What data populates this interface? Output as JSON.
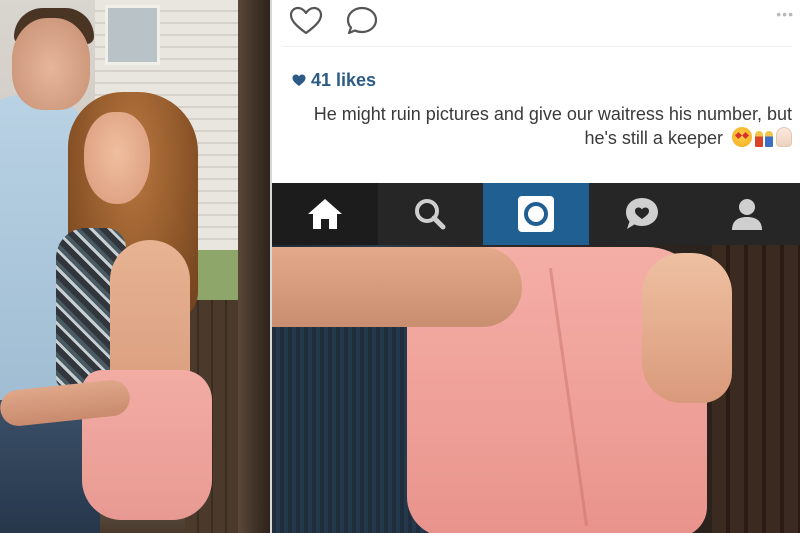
{
  "post": {
    "likes": "41 likes",
    "caption": "He might ruin pictures and give our waitress his number, but he's still a keeper",
    "caption_emojis": [
      "heart-eyes-emoji",
      "couple-emoji",
      "ok-hand-emoji"
    ],
    "more_menu_text": "•••"
  },
  "actions": [
    {
      "name": "like-button",
      "icon": "heart-outline-icon"
    },
    {
      "name": "comment-button",
      "icon": "comment-bubble-icon"
    }
  ],
  "nav": {
    "items": [
      {
        "name": "nav-home",
        "icon": "home-icon"
      },
      {
        "name": "nav-explore",
        "icon": "search-icon"
      },
      {
        "name": "nav-camera",
        "icon": "camera-icon",
        "active": true
      },
      {
        "name": "nav-activity",
        "icon": "heart-bubble-icon"
      },
      {
        "name": "nav-profile",
        "icon": "profile-icon"
      }
    ]
  },
  "colors": {
    "likes_text": "#2b5b86",
    "nav_background": "#262626",
    "nav_active": "#1f5f92"
  }
}
